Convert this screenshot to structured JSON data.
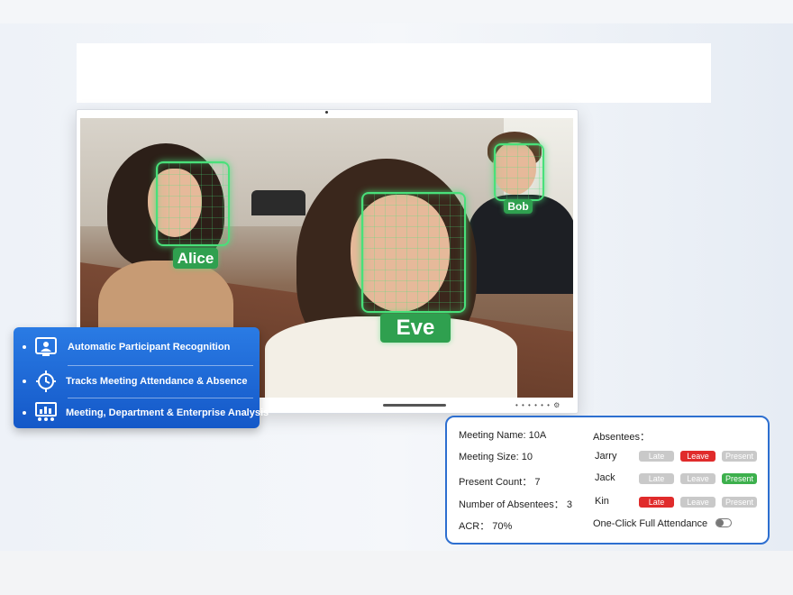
{
  "scene": {
    "detected_names": [
      "Alice",
      "Eve",
      "Bob"
    ],
    "screen_dots": "• • • • • • ⚙"
  },
  "features": {
    "items": [
      {
        "label": "Automatic Participant Recognition",
        "icon": "person-monitor-icon"
      },
      {
        "label": "Tracks Meeting Attendance & Absence",
        "icon": "clock-arrows-icon"
      },
      {
        "label": "Meeting, Department & Enterprise Analysis",
        "icon": "analytics-people-icon"
      }
    ]
  },
  "attendance": {
    "meeting_name": "Meeting Name: 10A",
    "meeting_size": "Meeting Size: 10",
    "present_count": "Present Count：  7",
    "absentees_count": "Number of Absentees：  3",
    "acr": "ACR：  70%",
    "absentees_heading": "Absentees：",
    "one_click": "One-Click Full Attendance",
    "one_click_on": false,
    "status_labels": {
      "late": "Late",
      "leave": "Leave",
      "present": "Present"
    },
    "absentees": [
      {
        "name": "Jarry",
        "selected": "leave"
      },
      {
        "name": "Jack",
        "selected": "present"
      },
      {
        "name": "Kin",
        "selected": "late"
      }
    ],
    "colors": {
      "late": "#e02b2b",
      "leave": "#e02b2b",
      "present": "#3db04d",
      "inactive": "#c9c9c9",
      "border": "#2d6fd0"
    }
  }
}
